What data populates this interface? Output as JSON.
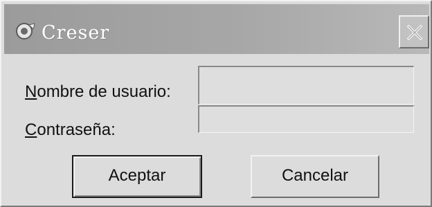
{
  "window": {
    "title": "Creser",
    "icon": "app-icon",
    "close_icon": "close-icon"
  },
  "form": {
    "username_label_mnemonic": "N",
    "username_label_rest": "ombre de usuario:",
    "username_value": "",
    "password_label_mnemonic": "C",
    "password_label_rest": "ontraseña:",
    "password_value": ""
  },
  "buttons": {
    "ok_label": "Aceptar",
    "cancel_label": "Cancelar"
  },
  "colors": {
    "titlebar": "#a0a0a0",
    "dialog_face": "#dcdcdc",
    "title_text": "#ffffff"
  }
}
